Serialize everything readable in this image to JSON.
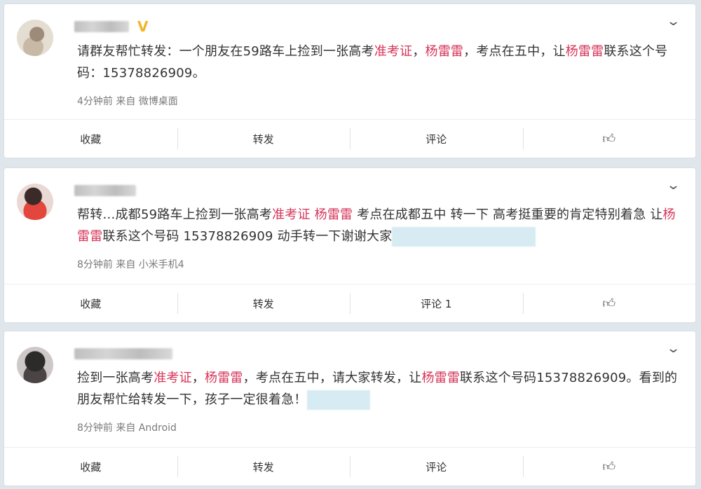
{
  "posts": [
    {
      "segments": [
        {
          "t": "请群友帮忙转发：一个朋友在59路车上捡到一张高考",
          "hl": false
        },
        {
          "t": "准考证",
          "hl": true
        },
        {
          "t": "，",
          "hl": false
        },
        {
          "t": "杨雷雷",
          "hl": true
        },
        {
          "t": "，考点在五中，让",
          "hl": false
        },
        {
          "t": "杨雷雷",
          "hl": true
        },
        {
          "t": "联系这个号码：15378826909。",
          "hl": false
        }
      ],
      "meta": "4分钟前 来自 微博桌面",
      "actions": {
        "favorite": "收藏",
        "repost": "转发",
        "comment": "评论"
      },
      "verified_badge": "V"
    },
    {
      "segments": [
        {
          "t": "帮转…成都59路车上捡到一张高考",
          "hl": false
        },
        {
          "t": "准考证",
          "hl": true
        },
        {
          "t": " ",
          "hl": false
        },
        {
          "t": "杨雷雷",
          "hl": true
        },
        {
          "t": " 考点在成都五中 转一下 高考挺重要的肯定特别着急 让",
          "hl": false
        },
        {
          "t": "杨雷雷",
          "hl": true
        },
        {
          "t": "联系这个号码 15378826909 动手转一下谢谢大家",
          "hl": false
        }
      ],
      "meta": "8分钟前 来自 小米手机4",
      "actions": {
        "favorite": "收藏",
        "repost": "转发",
        "comment": "评论 1"
      }
    },
    {
      "segments": [
        {
          "t": "捡到一张高考",
          "hl": false
        },
        {
          "t": "准考证",
          "hl": true
        },
        {
          "t": "，",
          "hl": false
        },
        {
          "t": "杨雷雷",
          "hl": true
        },
        {
          "t": "，考点在五中，请大家转发，让",
          "hl": false
        },
        {
          "t": "杨雷雷",
          "hl": true
        },
        {
          "t": "联系这个号码15378826909。看到的朋友帮忙给转发一下，孩子一定很着急！",
          "hl": false
        }
      ],
      "meta": "8分钟前 来自 Android",
      "actions": {
        "favorite": "收藏",
        "repost": "转发",
        "comment": "评论"
      }
    }
  ],
  "icons": {
    "collapse": "chevron-down-icon",
    "like": "thumbs-up-icon"
  },
  "colors": {
    "highlight": "#d6355a",
    "verified": "#f1b52b",
    "background": "#dfe6ec"
  }
}
